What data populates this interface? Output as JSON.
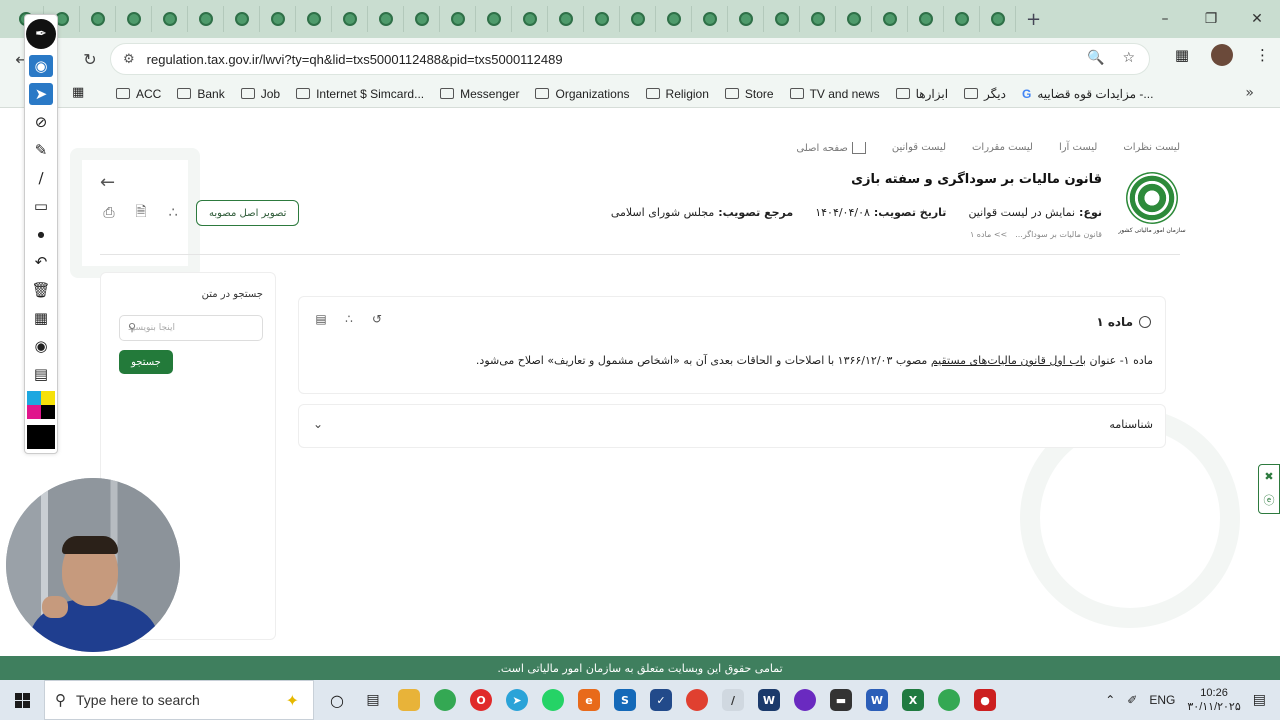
{
  "browser": {
    "tab_count": 28,
    "new_tab_label": "+",
    "url": "regulation.tax.gov.ir/lwvi?ty=qh&lid=txs5000112488&pid=txs5000112489",
    "bookmarks": [
      {
        "label": "ACC",
        "type": "folder"
      },
      {
        "label": "Bank",
        "type": "folder"
      },
      {
        "label": "Job",
        "type": "folder"
      },
      {
        "label": "Internet $ Simcard...",
        "type": "folder"
      },
      {
        "label": "Messenger",
        "type": "folder"
      },
      {
        "label": "Organizations",
        "type": "folder"
      },
      {
        "label": "Religion",
        "type": "folder"
      },
      {
        "label": "Store",
        "type": "folder"
      },
      {
        "label": "TV and news",
        "type": "folder"
      },
      {
        "label": "ابزارها",
        "type": "folder"
      },
      {
        "label": "دیگر",
        "type": "folder"
      },
      {
        "label": "مزایدات قوه قضاییه -...",
        "type": "google"
      }
    ]
  },
  "page": {
    "nav": {
      "home": "صفحه اصلی",
      "laws": "لیست قوانین",
      "regulations": "لیست مقررات",
      "rulings": "لیست آرا",
      "opinions": "لیست نظرات"
    },
    "logo_caption": "سازمان امور مالیاتی کشور",
    "law_title": "قانون مالیات بر سوداگری و سفته بازی",
    "meta": {
      "type_label": "نوع:",
      "type_value": "نمایش در لیست قوانین",
      "date_label": "تاریخ تصویب:",
      "date_value": "۱۴۰۴/۰۴/۰۸",
      "authority_label": "مرجع تصویب:",
      "authority_value": "مجلس شورای اسلامی"
    },
    "breadcrumb": {
      "part1": "قانون مالیات بر سوداگر...",
      "part2": ">> ماده ۱"
    },
    "original_button": "تصویر اصل مصوبه",
    "search_panel": {
      "title": "جستجو در متن",
      "placeholder": "اینجا بنویسید",
      "button": "جستجو"
    },
    "article": {
      "title": "ماده ۱",
      "text_start": "ماده ۱- عنوان ",
      "link_text": "باب اول قانون مالیات‌های مستقیم",
      "text_end": " مصوب ۱۳۶۶/۱۲/۰۳ با اصلاحات و الحاقات بعدی آن به «اشخاص مشمول و تعاریف» اصلاح می‌شود."
    },
    "identity_section": "شناسنامه",
    "footer": "تمامی حقوق این وبسایت متعلق به سازمان امور مالیاتی است."
  },
  "taskbar": {
    "search_placeholder": "Type here to search",
    "language": "ENG",
    "time": "10:26",
    "date": "۳۰/۱۱/۲۰۲۵"
  },
  "colors": {
    "accent_green": "#237a3a",
    "footer_green": "#3f7f5e",
    "tab_strip": "#c9ddd0"
  },
  "icons": {
    "annotation_tools": [
      "pen-icon",
      "eye-icon",
      "cursor-icon",
      "eraser-icon",
      "highlighter-icon",
      "line-icon",
      "ruler-icon",
      "dot-icon",
      "undo-icon",
      "trash-icon",
      "whiteboard-icon",
      "camera-icon",
      "clipboard-icon"
    ]
  }
}
